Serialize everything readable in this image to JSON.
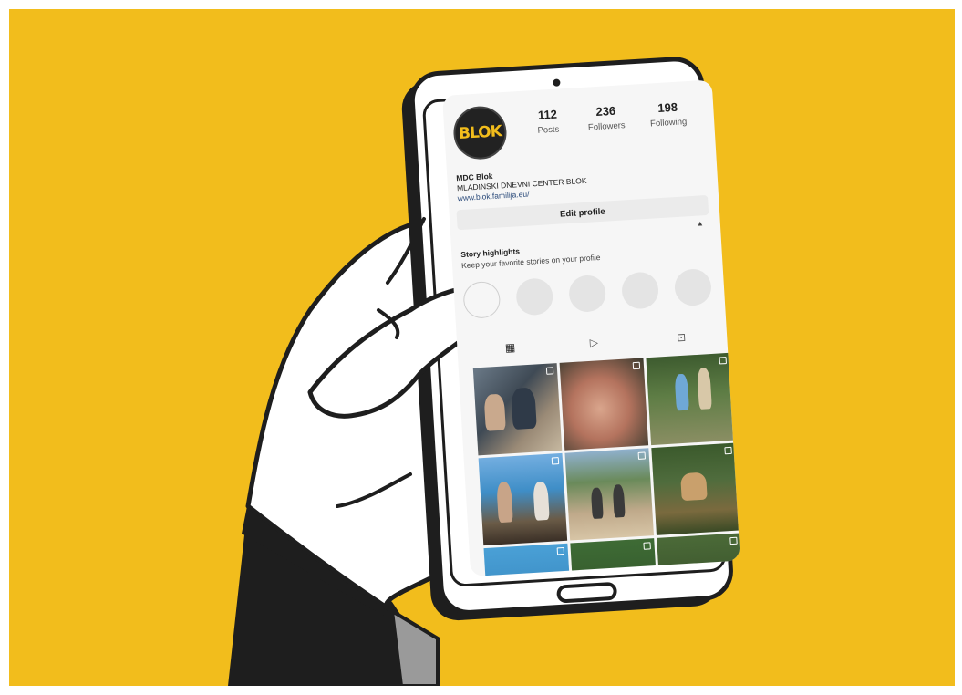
{
  "colors": {
    "background": "#f2bd1c",
    "outline": "#1e1e1e",
    "phone_body": "#ffffff",
    "sleeve": "#1e1e1e",
    "logo_accent": "#f2bd1c"
  },
  "profile": {
    "avatar_logo_text": "BLOK",
    "stats": [
      {
        "value": "112",
        "label": "Posts"
      },
      {
        "value": "236",
        "label": "Followers"
      },
      {
        "value": "198",
        "label": "Following"
      }
    ],
    "name": "MDC Blok",
    "description": "MLADINSKI DNEVNI CENTER BLOK",
    "website": "www.blok.familija.eu/",
    "edit_button": "Edit profile"
  },
  "highlights": {
    "title": "Story highlights",
    "subtitle": "Keep your favorite stories on your profile",
    "chevron_icon": "chevron-up-icon"
  },
  "tabs": [
    {
      "icon": "grid-icon",
      "glyph": "▦"
    },
    {
      "icon": "reels-play-icon",
      "glyph": "▷"
    },
    {
      "icon": "tagged-user-icon",
      "glyph": "⊡"
    }
  ],
  "posts": [
    {
      "icon": "multi-photo-icon"
    },
    {
      "icon": "multi-photo-icon"
    },
    {
      "icon": "multi-photo-icon"
    },
    {
      "icon": "multi-photo-icon"
    },
    {
      "icon": "multi-photo-icon"
    },
    {
      "icon": "multi-photo-icon"
    },
    {
      "icon": "multi-photo-icon"
    },
    {
      "icon": "multi-photo-icon"
    },
    {
      "icon": "multi-photo-icon"
    }
  ]
}
